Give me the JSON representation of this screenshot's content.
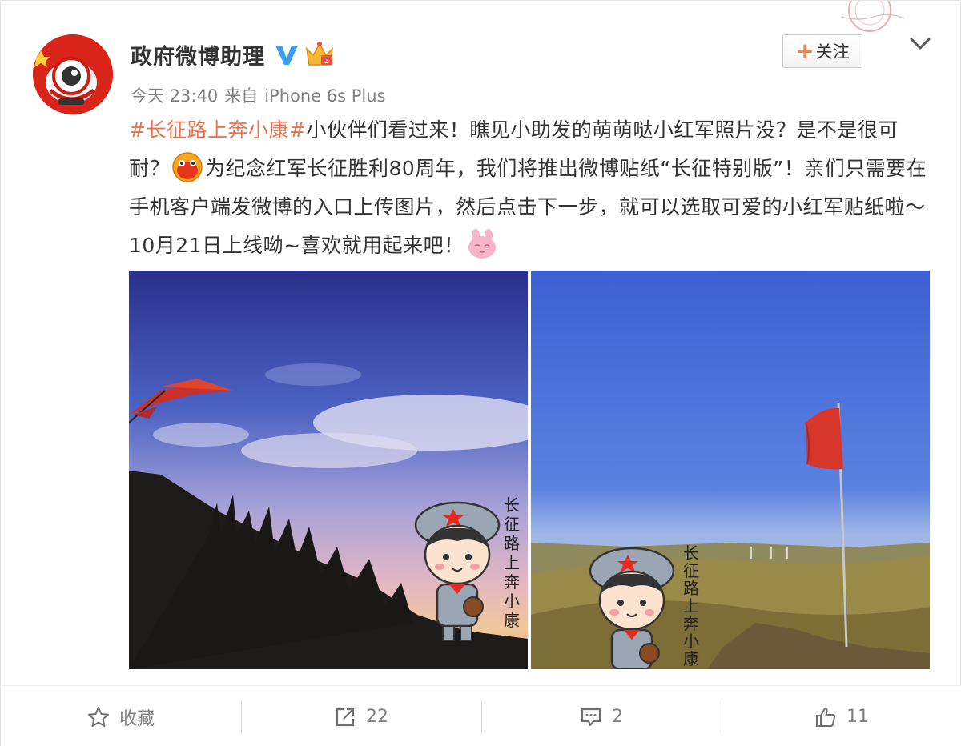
{
  "post": {
    "user_name": "政府微博助理",
    "time": "今天 23:40",
    "source_prefix": "来自",
    "source_device": "iPhone 6s Plus",
    "follow_label": "关注",
    "text_segments": {
      "hashtag": "#长征路上奔小康#",
      "part1": "小伙伴们看过来！瞧见小助发的萌萌哒小红军照片没？是不是很可耐？",
      "part2": "为纪念红军长征胜利80周年，我们将推出微博贴纸“长征特别版”！亲们只需要在手机客户端发微博的入口上传图片，然后点击下一步，就可以选取可爱的小红军贴纸啦～10月21日上线呦~喜欢就用起来吧！"
    },
    "sticker_caption": "长征路上奔小康"
  },
  "actions": {
    "favorite_label": "收藏",
    "repost_count": "22",
    "comment_count": "2",
    "like_count": "11"
  },
  "icons": {
    "verify": "verified-v-icon",
    "member": "crown-member-icon",
    "menu": "chevron-down-icon",
    "favorite": "star-icon",
    "repost": "share-arrow-icon",
    "comment": "comment-bubble-icon",
    "like": "thumbs-up-icon"
  },
  "colors": {
    "hashtag": "#eb7350",
    "verify_blue": "#3a9ef2",
    "follow_plus": "#ff8140"
  }
}
